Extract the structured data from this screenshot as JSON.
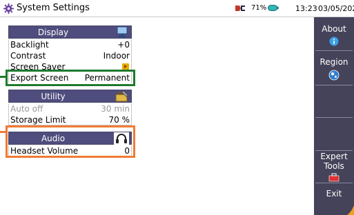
{
  "titlebar": {
    "title": "System Settings",
    "battery_pct": "71%",
    "time": "13:23",
    "date": "03/05/2022"
  },
  "sections": {
    "display": {
      "header": "Display",
      "rows": [
        {
          "label": "Backlight",
          "value": "+0"
        },
        {
          "label": "Contrast",
          "value": "Indoor"
        },
        {
          "label": "Screen Saver",
          "value": ""
        },
        {
          "label": "Export Screen",
          "value": "Permanent"
        }
      ]
    },
    "utility": {
      "header": "Utility",
      "rows": [
        {
          "label": "Auto off",
          "value": "30 min"
        },
        {
          "label": "Storage Limit",
          "value": "70 %"
        }
      ]
    },
    "audio": {
      "header": "Audio",
      "rows": [
        {
          "label": "Headset Volume",
          "value": "0"
        }
      ]
    }
  },
  "right_menu": {
    "about": "About",
    "region": "Region",
    "expert_tools_1": "Expert",
    "expert_tools_2": "Tools",
    "exit": "Exit"
  },
  "colors": {
    "section_header": "#4f4d7d",
    "right_panel": "#45435a",
    "highlight_green": "#1e7a2c",
    "highlight_orange": "#f07a35"
  },
  "icons": [
    "gear-icon",
    "vendor-logo-icon",
    "battery-icon",
    "monitor-icon",
    "toolbox-icon",
    "headset-icon",
    "info-icon",
    "globe-icon",
    "toolkit-icon"
  ]
}
